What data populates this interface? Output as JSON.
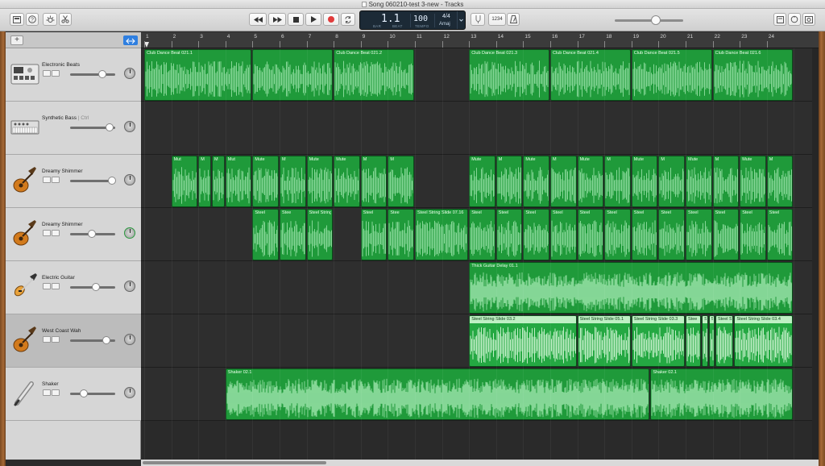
{
  "window": {
    "title": "Song 060210-test 3-new - Tracks"
  },
  "toolbar": {
    "lcd": {
      "bar_beat": "1.1",
      "bar_label": "BAR",
      "beat_label": "BEAT",
      "tempo": "100",
      "tempo_label": "TEMPO",
      "signature": "4/4",
      "key": "Amaj"
    },
    "count_in_label": "1234",
    "colors": {
      "record": "#e13c3c",
      "lcd_bg": "#1c2a36"
    }
  },
  "ruler": {
    "bars": [
      "1",
      "2",
      "3",
      "4",
      "5",
      "6",
      "7",
      "8",
      "9",
      "10",
      "11",
      "12",
      "13",
      "14",
      "15",
      "16",
      "17",
      "18",
      "19",
      "20",
      "21",
      "22",
      "23",
      "24"
    ]
  },
  "tracks": [
    {
      "name": "Electronic Beats",
      "mode": "",
      "icon": "drum-machine-icon",
      "volume": 0.72,
      "selected": false
    },
    {
      "name": "Synthetic Bass",
      "mode": "| Ctrl",
      "icon": "synth-icon",
      "volume": 0.88,
      "selected": false
    },
    {
      "name": "Dreamy Shimmer",
      "mode": "",
      "icon": "guitar-icon",
      "volume": 0.92,
      "selected": false
    },
    {
      "name": "Dreamy Shimmer",
      "mode": "",
      "icon": "guitar-icon",
      "volume": 0.48,
      "selected": false
    },
    {
      "name": "Electric Guitar",
      "mode": "",
      "icon": "electric-guitar-icon",
      "volume": 0.58,
      "selected": false
    },
    {
      "name": "West Coast Wah",
      "mode": "",
      "icon": "guitar-icon",
      "volume": 0.8,
      "selected": true
    },
    {
      "name": "Shaker",
      "mode": "",
      "icon": "shaker-icon",
      "volume": 0.3,
      "selected": false
    }
  ],
  "regions": [
    {
      "track": 0,
      "start": 1,
      "end": 5,
      "name": "Club Dance Beat 021.1",
      "style": "dark"
    },
    {
      "track": 0,
      "start": 5,
      "end": 8,
      "name": "",
      "style": "dark"
    },
    {
      "track": 0,
      "start": 8,
      "end": 11,
      "name": "Club Dance Beat 021.2",
      "style": "dark"
    },
    {
      "track": 0,
      "start": 13,
      "end": 16,
      "name": "Club Dance Beat 021.3",
      "style": "dark"
    },
    {
      "track": 0,
      "start": 16,
      "end": 19,
      "name": "Club Dance Beat 021.4",
      "style": "dark"
    },
    {
      "track": 0,
      "start": 19,
      "end": 22,
      "name": "Club Dance Beat 021.5",
      "style": "dark"
    },
    {
      "track": 0,
      "start": 22,
      "end": 25,
      "name": "Club Dance Beat 021.6",
      "style": "dark"
    },
    {
      "track": 2,
      "start": 2,
      "end": 3,
      "name": "Mut",
      "style": "dark"
    },
    {
      "track": 2,
      "start": 3,
      "end": 3.5,
      "name": "M",
      "style": "dark"
    },
    {
      "track": 2,
      "start": 3.5,
      "end": 4,
      "name": "M",
      "style": "dark"
    },
    {
      "track": 2,
      "start": 4,
      "end": 5,
      "name": "Mut",
      "style": "dark"
    },
    {
      "track": 2,
      "start": 5,
      "end": 6,
      "name": "Mute",
      "style": "dark"
    },
    {
      "track": 2,
      "start": 6,
      "end": 7,
      "name": "M",
      "style": "dark"
    },
    {
      "track": 2,
      "start": 7,
      "end": 8,
      "name": "Mute",
      "style": "dark"
    },
    {
      "track": 2,
      "start": 8,
      "end": 9,
      "name": "Mute",
      "style": "dark"
    },
    {
      "track": 2,
      "start": 9,
      "end": 10,
      "name": "M",
      "style": "dark"
    },
    {
      "track": 2,
      "start": 10,
      "end": 11,
      "name": "M",
      "style": "dark"
    },
    {
      "track": 2,
      "start": 13,
      "end": 14,
      "name": "Mute",
      "style": "dark"
    },
    {
      "track": 2,
      "start": 14,
      "end": 15,
      "name": "M",
      "style": "dark"
    },
    {
      "track": 2,
      "start": 15,
      "end": 16,
      "name": "Mute",
      "style": "dark"
    },
    {
      "track": 2,
      "start": 16,
      "end": 17,
      "name": "M",
      "style": "dark"
    },
    {
      "track": 2,
      "start": 17,
      "end": 18,
      "name": "Mute",
      "style": "dark"
    },
    {
      "track": 2,
      "start": 18,
      "end": 19,
      "name": "M",
      "style": "dark"
    },
    {
      "track": 2,
      "start": 19,
      "end": 20,
      "name": "Mute",
      "style": "dark"
    },
    {
      "track": 2,
      "start": 20,
      "end": 21,
      "name": "M",
      "style": "dark"
    },
    {
      "track": 2,
      "start": 21,
      "end": 22,
      "name": "Mute",
      "style": "dark"
    },
    {
      "track": 2,
      "start": 22,
      "end": 23,
      "name": "M",
      "style": "dark"
    },
    {
      "track": 2,
      "start": 23,
      "end": 24,
      "name": "Mute",
      "style": "dark"
    },
    {
      "track": 2,
      "start": 24,
      "end": 25,
      "name": "M",
      "style": "dark"
    },
    {
      "track": 3,
      "start": 5,
      "end": 6,
      "name": "Steel",
      "style": "dark"
    },
    {
      "track": 3,
      "start": 6,
      "end": 7,
      "name": "Stee",
      "style": "dark"
    },
    {
      "track": 3,
      "start": 7,
      "end": 8,
      "name": "Steel String Slide 07.7",
      "style": "dark"
    },
    {
      "track": 3,
      "start": 9,
      "end": 10,
      "name": "Steel",
      "style": "dark"
    },
    {
      "track": 3,
      "start": 10,
      "end": 11,
      "name": "Stee",
      "style": "dark"
    },
    {
      "track": 3,
      "start": 11,
      "end": 13,
      "name": "Steel String Slide 07.16",
      "style": "dark"
    },
    {
      "track": 3,
      "start": 13,
      "end": 14,
      "name": "Steel",
      "style": "dark"
    },
    {
      "track": 3,
      "start": 14,
      "end": 15,
      "name": "Steel",
      "style": "dark"
    },
    {
      "track": 3,
      "start": 15,
      "end": 16,
      "name": "Steel",
      "style": "dark"
    },
    {
      "track": 3,
      "start": 16,
      "end": 17,
      "name": "Steel",
      "style": "dark"
    },
    {
      "track": 3,
      "start": 17,
      "end": 18,
      "name": "Steel",
      "style": "dark"
    },
    {
      "track": 3,
      "start": 18,
      "end": 19,
      "name": "Steel",
      "style": "dark"
    },
    {
      "track": 3,
      "start": 19,
      "end": 20,
      "name": "Steel",
      "style": "dark"
    },
    {
      "track": 3,
      "start": 20,
      "end": 21,
      "name": "Steel",
      "style": "dark"
    },
    {
      "track": 3,
      "start": 21,
      "end": 22,
      "name": "Steel",
      "style": "dark"
    },
    {
      "track": 3,
      "start": 22,
      "end": 23,
      "name": "Steel",
      "style": "dark"
    },
    {
      "track": 3,
      "start": 23,
      "end": 24,
      "name": "Steel",
      "style": "dark"
    },
    {
      "track": 3,
      "start": 24,
      "end": 25,
      "name": "Steel",
      "style": "dark"
    },
    {
      "track": 4,
      "start": 13,
      "end": 25,
      "name": "Thick Guitar Delay 01.1",
      "style": "dark"
    },
    {
      "track": 5,
      "start": 13,
      "end": 17,
      "name": "Steel String Slide 03.2",
      "style": "light"
    },
    {
      "track": 5,
      "start": 17,
      "end": 19,
      "name": "Steel String Slide 05.1",
      "style": "light"
    },
    {
      "track": 5,
      "start": 19,
      "end": 21,
      "name": "Steel String Slide 03.3",
      "style": "light"
    },
    {
      "track": 5,
      "start": 21,
      "end": 21.6,
      "name": "Stee",
      "style": "light"
    },
    {
      "track": 5,
      "start": 21.6,
      "end": 21.85,
      "name": "S",
      "style": "light"
    },
    {
      "track": 5,
      "start": 21.85,
      "end": 22.1,
      "name": "S",
      "style": "light"
    },
    {
      "track": 5,
      "start": 22.1,
      "end": 22.8,
      "name": "Steel St",
      "style": "light"
    },
    {
      "track": 5,
      "start": 22.8,
      "end": 25,
      "name": "Steel String Slide 03.4",
      "style": "light"
    },
    {
      "track": 6,
      "start": 4,
      "end": 19.7,
      "name": "Shaker 02.1",
      "style": "dark"
    },
    {
      "track": 6,
      "start": 19.7,
      "end": 25,
      "name": "Shaker 02.1",
      "style": "dark"
    }
  ]
}
